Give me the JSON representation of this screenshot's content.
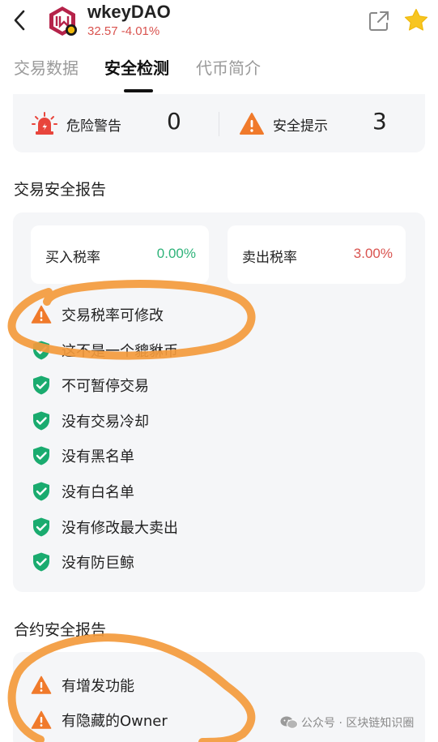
{
  "header": {
    "token_name": "wkeyDAO",
    "token_price": "32.57 -4.01%",
    "price_color": "#d9534f"
  },
  "tabs": [
    {
      "label": "交易数据",
      "active": false
    },
    {
      "label": "安全检测",
      "active": true
    },
    {
      "label": "代币简介",
      "active": false
    }
  ],
  "alerts": {
    "danger_label": "危险警告",
    "danger_count": "0",
    "warning_label": "安全提示",
    "warning_count": "3"
  },
  "trade_report": {
    "title": "交易安全报告",
    "buy_tax_label": "买入税率",
    "buy_tax_value": "0.00%",
    "sell_tax_label": "卖出税率",
    "sell_tax_value": "3.00%",
    "items": [
      {
        "text": "交易税率可修改",
        "status": "warning"
      },
      {
        "text": "这不是一个貔貅币",
        "status": "safe"
      },
      {
        "text": "不可暂停交易",
        "status": "safe"
      },
      {
        "text": "没有交易冷却",
        "status": "safe"
      },
      {
        "text": "没有黑名单",
        "status": "safe"
      },
      {
        "text": "没有白名单",
        "status": "safe"
      },
      {
        "text": "没有修改最大卖出",
        "status": "safe"
      },
      {
        "text": "没有防巨鲸",
        "status": "safe"
      }
    ]
  },
  "contract_report": {
    "title": "合约安全报告",
    "items": [
      {
        "text": "有增发功能",
        "status": "warning"
      },
      {
        "text": "有隐藏的Owner",
        "status": "warning"
      }
    ]
  },
  "watermark": "公众号 · 区块链知识圈",
  "colors": {
    "safe": "#1aab6f",
    "warning": "#f07a2b",
    "danger": "#e8453c",
    "buy_tax": "#2fb37a",
    "sell_tax": "#d9534f",
    "annotation": "#f39a3c"
  },
  "icons": {
    "back": "back-arrow-icon",
    "share": "share-icon",
    "favorite": "star-icon",
    "danger": "siren-icon",
    "warning": "warning-triangle-icon",
    "safe": "shield-check-icon"
  }
}
